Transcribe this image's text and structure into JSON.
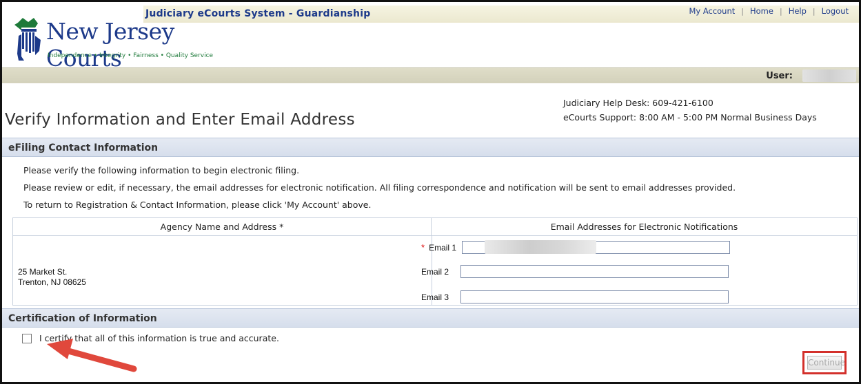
{
  "header": {
    "system_title": "Judiciary eCourts System - Guardianship",
    "nav": [
      "My Account",
      "Home",
      "Help",
      "Logout"
    ],
    "logo_title": "New Jersey Courts",
    "logo_tagline": "Independence • Integrity • Fairness • Quality Service",
    "user_label": "User:"
  },
  "page": {
    "title": "Verify Information and Enter Email Address",
    "helpdesk_line1": "Judiciary Help Desk: 609-421-6100",
    "helpdesk_line2": "eCourts Support: 8:00 AM - 5:00 PM Normal Business Days"
  },
  "contact": {
    "section_title": "eFiling Contact Information",
    "instructions": [
      "Please verify the following information to begin electronic filing.",
      "Please review or edit, if necessary, the email addresses for electronic notification. All filing correspondence and notification will be sent to email addresses provided.",
      "To return to Registration & Contact Information, please click 'My Account' above."
    ],
    "col_agency": "Agency Name and Address *",
    "col_emails": "Email Addresses for Electronic Notifications",
    "address_line1": "25 Market St.",
    "address_line2": "Trenton, NJ 08625",
    "required_mark": "*",
    "emails": [
      {
        "label": "Email 1",
        "value": ""
      },
      {
        "label": "Email 2",
        "value": ""
      },
      {
        "label": "Email 3",
        "value": ""
      }
    ]
  },
  "certification": {
    "section_title": "Certification of Information",
    "checkbox_label": "I certify that all of this information is true and accurate.",
    "checked": false,
    "continue_label": "Continue"
  },
  "colors": {
    "brand_blue": "#1d3a8a",
    "header_band": "#d3d1bb",
    "section_header": "#d6deec",
    "highlight_red": "#d3302b",
    "arrow_red": "#e0483c"
  },
  "icons": [
    "nj-courts-logo-icon",
    "arrow-annotation-icon"
  ]
}
